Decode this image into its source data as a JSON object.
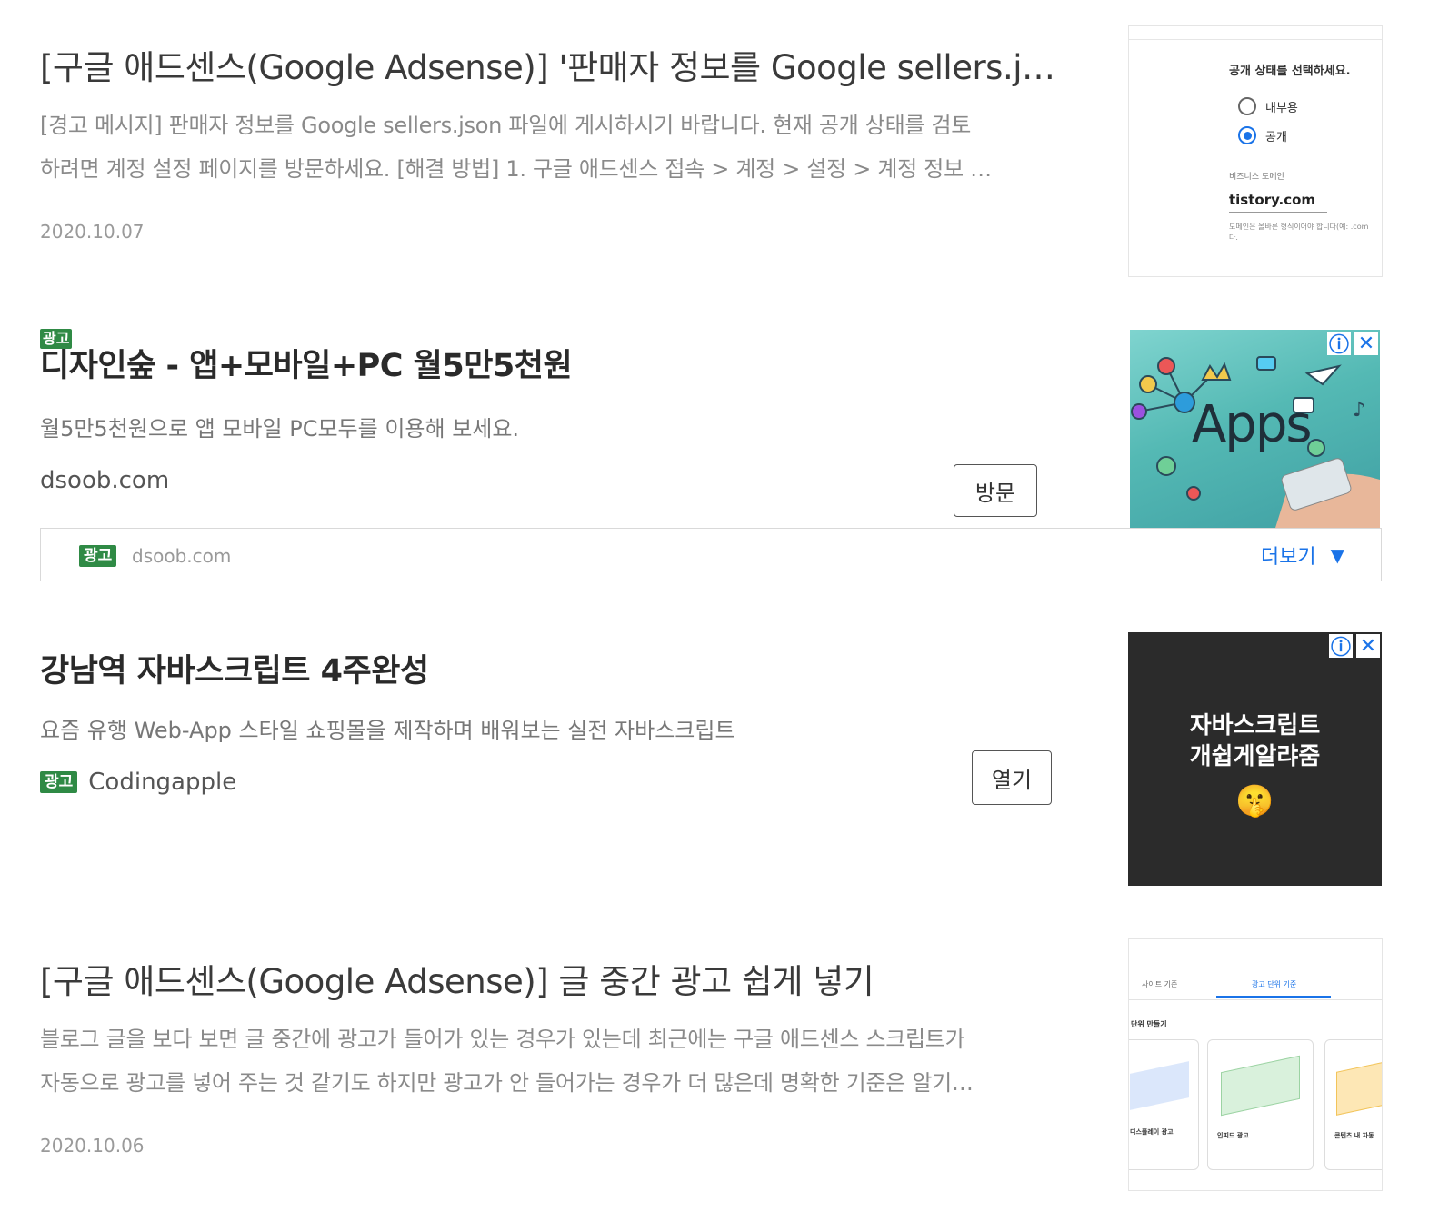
{
  "post1": {
    "title": "[구글 애드센스(Google Adsense)] '판매자 정보를 Google sellers.json 파일에 게시하시기 바랍니다'",
    "excerpt_line1": "[경고 메시지] 판매자 정보를 Google sellers.json 파일에 게시하시기 바랍니다. 현재 공개 상태를 검토",
    "excerpt_line2": "하려면 계정 설정 페이지를 방문하세요. [해결 방법] 1. 구글 애드센스 접속 > 계정 > 설정 > 계정 정보 …",
    "date": "2020.10.07",
    "thumb": {
      "question": "공개 상태를 선택하세요.",
      "option_internal": "내부용",
      "option_public": "공개",
      "domain_label": "비즈니스 도메인",
      "domain_value": "tistory.com",
      "hint": "도메인은 올바른 형식이어야 합니다(예: .com 다."
    }
  },
  "ad1": {
    "badge": "광고",
    "title": "디자인숲 - 앱+모바일+PC 월5만5천원",
    "desc": "월5만5천원으로 앱 모바일 PC모두를 이용해 보세요.",
    "domain": "dsoob.com",
    "button": "방문",
    "image_text": "Apps",
    "footer_badge": "광고",
    "footer_domain": "dsoob.com",
    "more": "더보기",
    "more_icon": "▼"
  },
  "ad2": {
    "title": "강남역 자바스크립트 4주완성",
    "desc": "요즘 유행 Web-App 스타일 쇼핑몰을 제작하며 배워보는 실전 자바스크립트",
    "badge": "광고",
    "advertiser": "Codingapple",
    "button": "열기",
    "image_line1": "자바스크립트",
    "image_line2": "개쉽게알랴줌",
    "image_emoji": "🤫"
  },
  "post2": {
    "title": "[구글 애드센스(Google Adsense)] 글 중간 광고 쉽게 넣기",
    "excerpt_line1": "블로그 글을 보다 보면 글 중간에 광고가 들어가 있는 경우가 있는데 최근에는 구글 애드센스 스크립트가",
    "excerpt_line2": "자동으로 광고를 넣어 주는 것 같기도 하지만 광고가 안 들어가는 경우가 더 많은데 명확한 기준은 알기…",
    "date": "2020.10.06",
    "thumb": {
      "tab1": "사이트 기준",
      "tab2": "광고 단위 기준",
      "heading": "단위 만들기",
      "card1_label": "디스플레이 광고",
      "card2_label": "인피드 광고",
      "card3_label": "콘텐츠 내 자동"
    }
  },
  "colors": {
    "ad_badge": "#2f8a45",
    "adchoice": "#1a73e8",
    "dark_ad_bg": "#2b2b2b"
  }
}
